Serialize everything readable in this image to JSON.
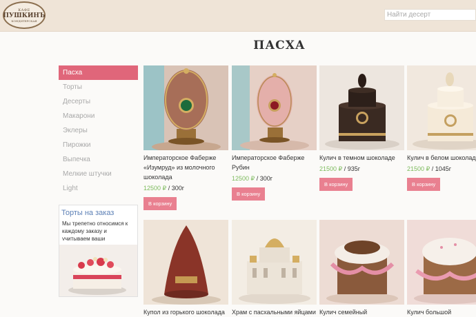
{
  "header": {
    "logo": {
      "line1": "КАФЕ",
      "line2": "ПУШКИНЪ",
      "line3": "КОНДИТЕРСКАЯ"
    },
    "search_placeholder": "Найти десерт"
  },
  "page_title": "ПАСХА",
  "sidebar": {
    "items": [
      {
        "label": "Пасха",
        "active": true
      },
      {
        "label": "Торты",
        "active": false
      },
      {
        "label": "Десерты",
        "active": false
      },
      {
        "label": "Макарони",
        "active": false
      },
      {
        "label": "Эклеры",
        "active": false
      },
      {
        "label": "Пирожки",
        "active": false
      },
      {
        "label": "Выпечка",
        "active": false
      },
      {
        "label": "Мелкие штучки",
        "active": false
      },
      {
        "label": "Light",
        "active": false
      }
    ],
    "promo": {
      "title": "Торты на заказ",
      "text": "Мы трепетно относимся к каждому заказу и учитываем ваши пожелания"
    }
  },
  "products": [
    {
      "name": "Императорское Фаберже «Изумруд» из молочного шоколада",
      "price": "12500 ₽",
      "weight": " / 300г",
      "button": "В корзину"
    },
    {
      "name": "Императорское Фаберже Рубин",
      "price": "12500 ₽",
      "weight": " / 300г",
      "button": "В корзину"
    },
    {
      "name": "Кулич в темном шоколаде",
      "price": "21500 ₽",
      "weight": " / 935г",
      "button": "В корзину"
    },
    {
      "name": "Кулич в белом шоколаде",
      "price": "21500 ₽",
      "weight": " / 1045г",
      "button": "В корзину"
    },
    {
      "name": "Купол из горького шоколада"
    },
    {
      "name": "Храм с пасхальными яйцами из"
    },
    {
      "name": "Кулич семейный"
    },
    {
      "name": "Кулич большой"
    }
  ],
  "colors": {
    "accent": "#e0667a",
    "button": "#e98090",
    "price": "#7cba5c",
    "link": "#5b7fb5"
  }
}
